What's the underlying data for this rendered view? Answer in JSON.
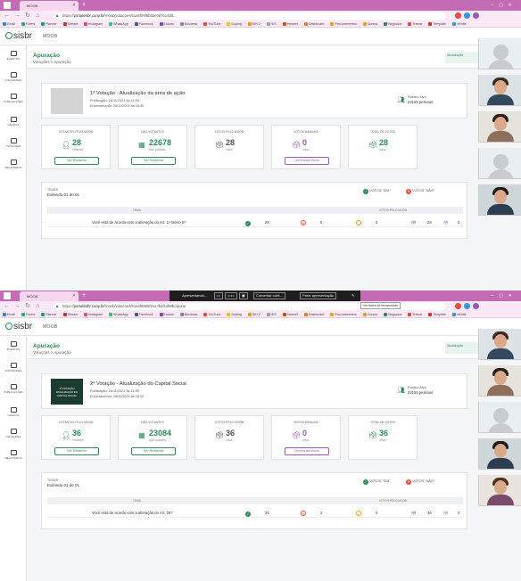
{
  "screens": [
    {
      "browser": {
        "tab_title": "MOOB",
        "url_prefix": "https://",
        "url_host": "portalsisbr.coop.br",
        "url_path": "/moob/votacoes/61a5f09f8b02e0d7b14d0...",
        "bookmarks": [
          "Email",
          "Forms",
          "Planner",
          "Stream",
          "Instagram",
          "WhatsApp",
          "Facebook",
          "Estudo",
          "Business",
          "YouTube",
          "Doping",
          "SIH 2",
          "SIS",
          "Intranet",
          "Dashboard",
          "Procuramentos",
          "Cursos",
          "Negócios",
          "Treinar",
          "Template",
          "Infinite"
        ]
      },
      "app": {
        "logo_text": "sisbr",
        "module": "MOOB",
        "page_title": "Apuração",
        "breadcrumb": "Votações > Apuração",
        "update_label": "Atualização",
        "sidebar": [
          "EVENTOS",
          "INSCRIÇÕES",
          "PUBLICAÇÕES",
          "GRUPOS",
          "VOTAÇÕES",
          "RELATÓRIOS"
        ],
        "voting": {
          "title": "1ª Votação - Atualização da área de ação",
          "publicacao": "Publicação: 26/11/2021 às 11:00",
          "encerramento": "Encerramento: 26/11/2021 às 16:00",
          "aptos_label": "Público Alvo",
          "aptos_value": "23155 pessoas"
        },
        "stats": [
          {
            "label": "VOTANTES PELO MOOB",
            "value": "28",
            "sub": "Votantes",
            "button": "Ver Relatório"
          },
          {
            "label": "NÃO VOTANTES",
            "value": "22678",
            "sub": "Não votantes",
            "button": "Ver Relatório"
          },
          {
            "label": "VOTOS PELO MOOB",
            "value": "28",
            "sub": "votos",
            "button": ""
          },
          {
            "label": "VOTOS MANUAIS",
            "value": "0",
            "sub": "votos",
            "button": "Gerenciar Votos"
          },
          {
            "label": "TOTAL DE VOTOS",
            "value": "28",
            "sub": "votos",
            "button": ""
          }
        ],
        "temas": {
          "label": "TEMAS",
          "showing": "Exibindo 01 de 01",
          "legend_sim": "VOTOS \"SIM\"",
          "legend_nao": "VOTOS \"NÃO\"",
          "col_tema": "TEMA",
          "col_votos": "VOTOS PELO MOOB",
          "question": "Você está de acordo com a alteração do Art. 1º Inciso II?",
          "sim": "28",
          "nao": "0",
          "abst": "0",
          "moob": "28",
          "manual": "0"
        }
      }
    },
    {
      "browser": {
        "tab_title": "MOOB",
        "url_prefix": "https://",
        "url_host": "portalsisbr.coop.br",
        "url_path": "/moob/votacoes/61a5f9886f2ee7b8f14b0b/apurar",
        "bookmarks": [
          "Email",
          "Forms",
          "Planner",
          "Stream",
          "Instagram",
          "WhatsApp",
          "Facebook",
          "Estudo",
          "Business",
          "YouTube",
          "Doping",
          "SIH 2",
          "SIS",
          "Intranet",
          "Dashboard",
          "Procuramentos",
          "Cursos",
          "Negócios",
          "Treinar",
          "Template",
          "Infinite"
        ]
      },
      "share_bar": {
        "presenting": "Apresentando...",
        "comment": "Comentar cont...",
        "stop": "Parar apresentação",
        "tooltip": "Ver barra de ferramentas"
      },
      "app": {
        "logo_text": "sisbr",
        "module": "MOOB",
        "page_title": "Apuração",
        "breadcrumb": "Votações > Apuração",
        "update_label": "Atualização",
        "sidebar": [
          "EVENTOS",
          "INSCRIÇÕES",
          "PUBLICAÇÕES",
          "GRUPOS",
          "VOTAÇÕES",
          "RELATÓRIOS"
        ],
        "voting": {
          "title": "2ª Votação - Atualização do Capital Social",
          "publicacao": "Publicação: 26/11/2021 às 11:00",
          "encerramento": "Encerramento: 26/11/2021 às 16:00",
          "aptos_label": "Público Alvo",
          "aptos_value": "23155 pessoas",
          "thumb_text": "2ª VOTAÇÃO ATUALIZAÇÃO DO CAPITAL SOCIAL"
        },
        "stats": [
          {
            "label": "VOTANTES PELO MOOB",
            "value": "36",
            "sub": "Votantes",
            "button": "Ver Relatório"
          },
          {
            "label": "NÃO VOTANTES",
            "value": "23084",
            "sub": "Não votantes",
            "button": "Ver Relatório"
          },
          {
            "label": "VOTOS PELO MOOB",
            "value": "36",
            "sub": "votos",
            "button": ""
          },
          {
            "label": "VOTOS MANUAIS",
            "value": "0",
            "sub": "votos",
            "button": "Gerenciar Votos"
          },
          {
            "label": "TOTAL DE VOTOS",
            "value": "36",
            "sub": "votos",
            "button": ""
          }
        ],
        "temas": {
          "label": "TEMAS",
          "showing": "Exibindo 01 de 01",
          "legend_sim": "VOTOS \"SIM\"",
          "legend_nao": "VOTOS \"NÃO\"",
          "col_tema": "TEMA",
          "col_votos": "VOTOS PELO MOOB",
          "question": "Você está de acordo com a alteração do Art. 25?",
          "sim": "34",
          "nao": "2",
          "abst": "0",
          "moob": "36",
          "manual": "0"
        }
      }
    }
  ],
  "colors": {
    "accent": "#2e8b57",
    "titlebar": "#c46bb5",
    "manual": "#9b59b6",
    "no": "#e74c3c",
    "abstain": "#f39c12"
  }
}
